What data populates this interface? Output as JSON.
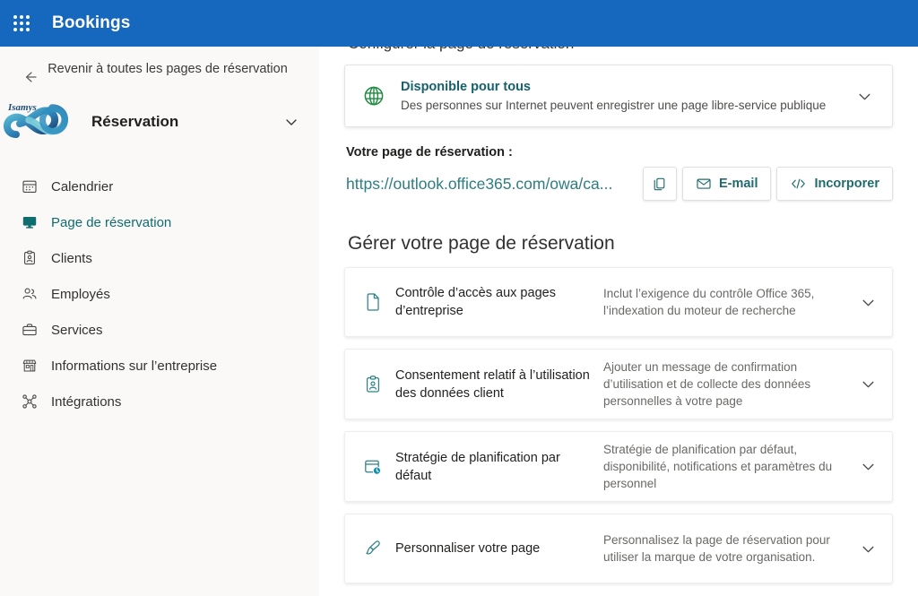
{
  "suite": {
    "app_launcher_name": "waffle-icon",
    "title": "Bookings",
    "brand_color": "#1668be"
  },
  "sidebar": {
    "back_label": "Revenir à toutes les pages de réservation",
    "logo_text": "Isamys",
    "business_name": "Réservation",
    "accent_color": "#0f6c6f",
    "items": [
      {
        "label": "Calendrier",
        "icon": "calendar-icon",
        "active": false
      },
      {
        "label": "Page de réservation",
        "icon": "monitor-icon",
        "active": true
      },
      {
        "label": "Clients",
        "icon": "clipboard-person-icon",
        "active": false
      },
      {
        "label": "Employés",
        "icon": "people-icon",
        "active": false
      },
      {
        "label": "Services",
        "icon": "briefcase-icon",
        "active": false
      },
      {
        "label": "Informations sur l’entreprise",
        "icon": "storefront-icon",
        "active": false
      },
      {
        "label": "Intégrations",
        "icon": "integrations-icon",
        "active": false
      }
    ]
  },
  "main": {
    "configure_heading": "Configurer la page de réservation",
    "availability": {
      "icon": "globe-icon",
      "icon_color": "#1f8b3f",
      "title": "Disponible pour tous",
      "subtitle": "Des personnes sur Internet peuvent enregistrer une page libre-service publique",
      "chevron": "chevron-down-icon"
    },
    "booking_url": {
      "label": "Votre page de réservation :",
      "url": "https://outlook.office365.com/owa/ca...",
      "link_color": "#2d7d82",
      "actions": [
        {
          "label": "",
          "icon": "copy-icon",
          "name": "copy-link-button"
        },
        {
          "label": "E-mail",
          "icon": "mail-icon",
          "name": "email-button"
        },
        {
          "label": "Incorporer",
          "icon": "embed-code-icon",
          "name": "embed-button"
        }
      ]
    },
    "manage_heading": "Gérer votre page de réservation",
    "manage_items": [
      {
        "icon": "document-icon",
        "title": "Contrôle d’accès aux pages d’entreprise",
        "description": "Inclut l’exigence du contrôle Office 365, l’indexation du moteur de recherche",
        "chevron": "chevron-down-icon"
      },
      {
        "icon": "clipboard-person-icon",
        "title": "Consentement relatif à l’utilisation des données client",
        "description": "Ajouter un message de confirmation d’utilisation et de collecte des données personnelles à votre page",
        "chevron": "chevron-down-icon"
      },
      {
        "icon": "calendar-clock-icon",
        "title": "Stratégie de planification par défaut",
        "description": "Stratégie de planification par défaut, disponibilité, notifications et paramètres du personnel",
        "chevron": "chevron-down-icon"
      },
      {
        "icon": "paintbrush-icon",
        "title": "Personnaliser votre page",
        "description": "Personnalisez la page de réservation pour utiliser la marque de votre organisation.",
        "chevron": "chevron-down-icon"
      }
    ]
  }
}
